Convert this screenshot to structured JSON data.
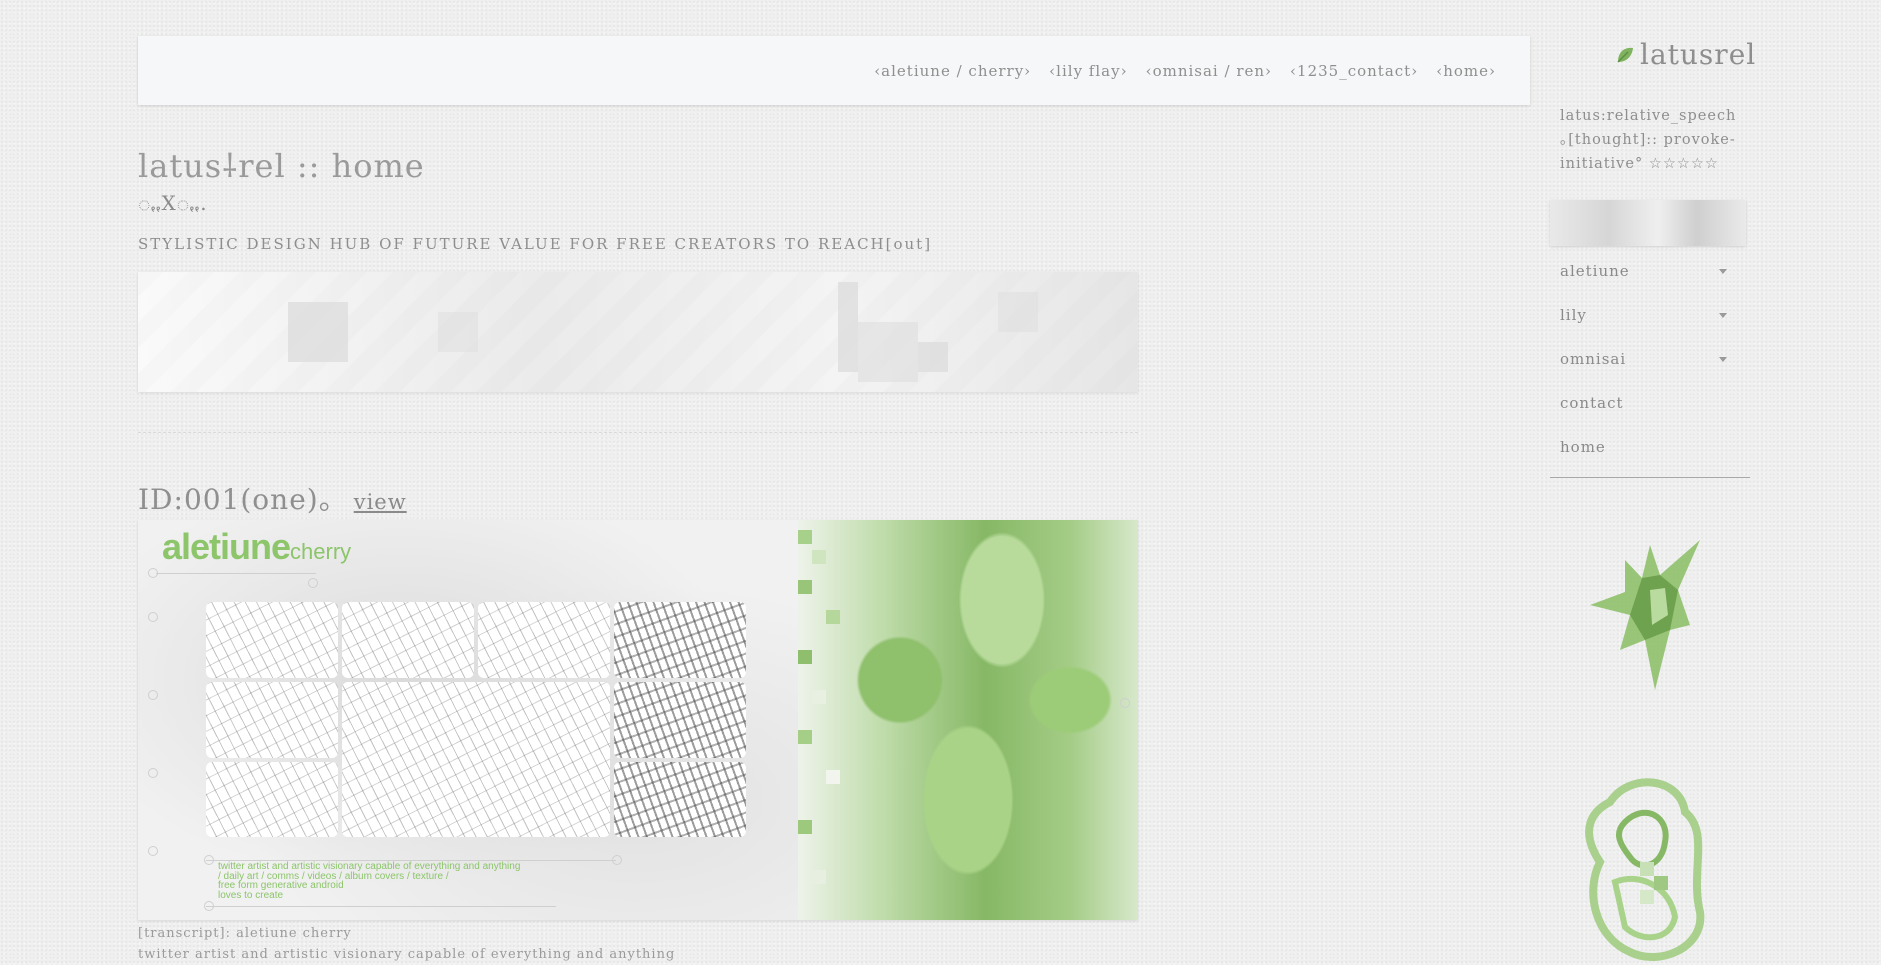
{
  "topbar": {
    "nav": [
      "‹aletiune / cherry›",
      "‹lily flay›",
      "‹omnisai / ren›",
      "‹1235_contact›",
      "‹home›"
    ]
  },
  "header": {
    "title": "latus⸸rel :: home",
    "subtitle": "ꩻꩻXꩻꩻ.",
    "tagline": "STYLISTIC DESIGN HUB OF FUTURE VALUE FOR FREE CREATORS TO REACH[out]"
  },
  "feature": {
    "id_label": "ID:001(one)。",
    "view_link": "view",
    "brand_main": "aletiune",
    "brand_sub": "cherry",
    "caption_lines": [
      "twitter artist and artistic visionary capable of everything and anything",
      "/ daily art / comms / videos / album covers / texture /",
      "free form generative android",
      "loves to create"
    ]
  },
  "transcript": {
    "line1": "[transcript]: aletiune cherry",
    "line2": "twitter artist and artistic visionary capable of everything and anything"
  },
  "sidebar": {
    "logo_text": "latusrel",
    "logo_icon": "leaf-icon",
    "description": "latus:relative_speech ｡[thought]:: provoke-initiative° ☆☆☆☆☆",
    "menu": [
      {
        "label": "aletiune",
        "has_dropdown": true
      },
      {
        "label": "lily",
        "has_dropdown": true
      },
      {
        "label": "omnisai",
        "has_dropdown": true
      },
      {
        "label": "contact",
        "has_dropdown": false
      },
      {
        "label": "home",
        "has_dropdown": false
      }
    ]
  },
  "colors": {
    "accent_green": "#8cc56a",
    "text_gray": "#8a8a8a",
    "background": "#eeefee"
  }
}
